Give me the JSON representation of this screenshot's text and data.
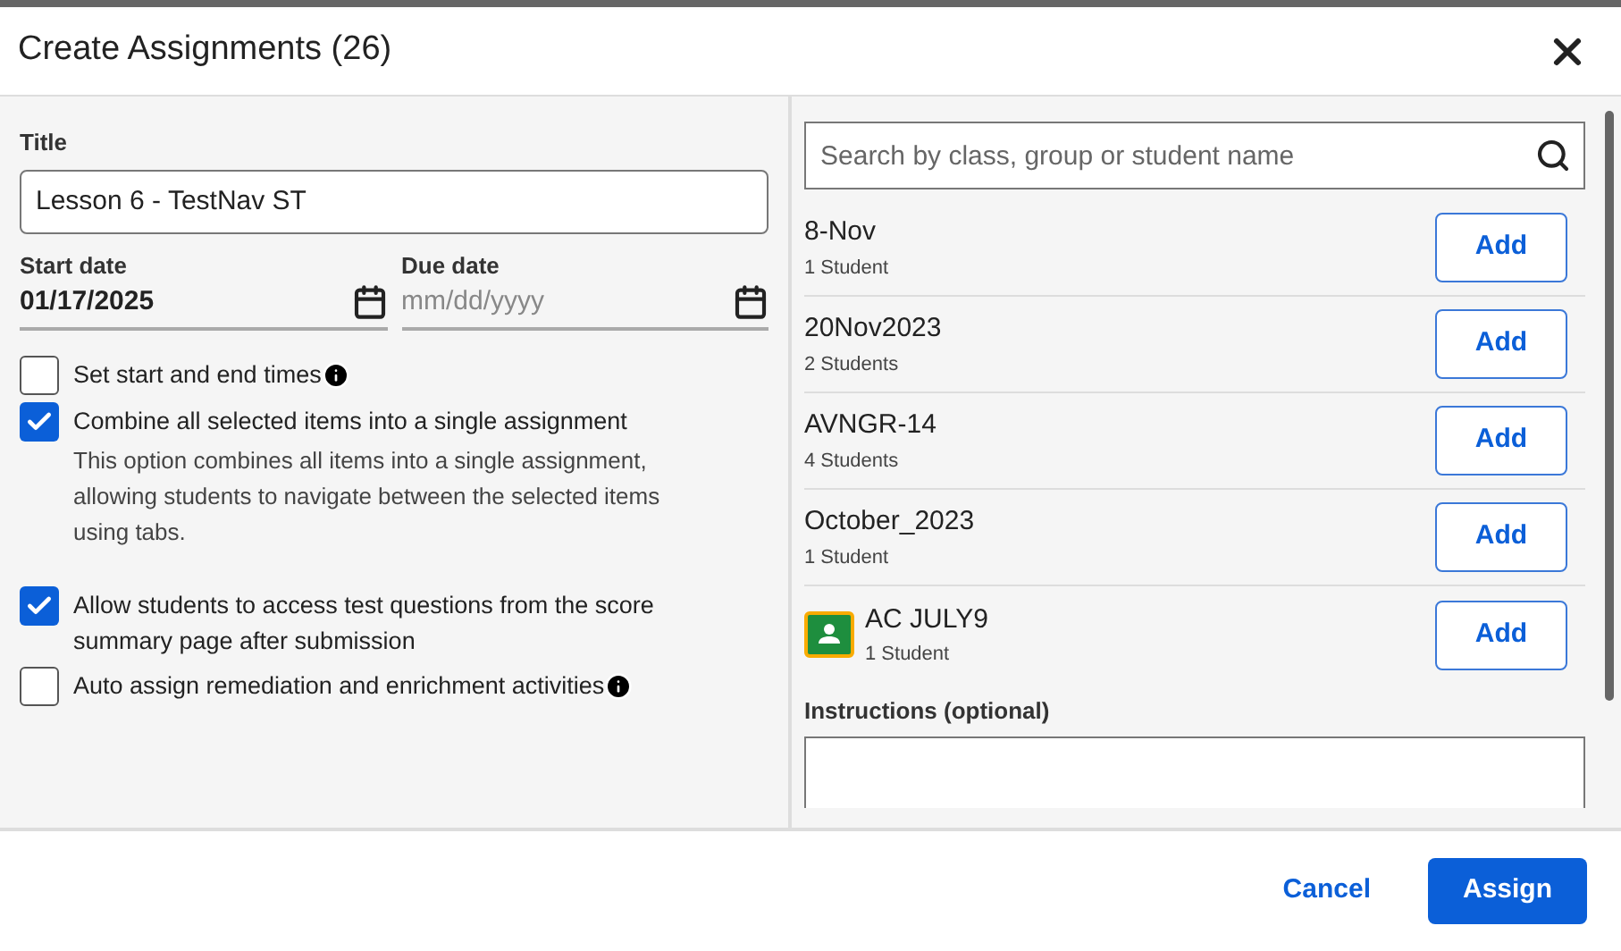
{
  "dialog": {
    "title": "Create Assignments (26)"
  },
  "form": {
    "title_label": "Title",
    "title_value": "Lesson 6 - TestNav ST",
    "start_date": {
      "label": "Start date",
      "value": "01/17/2025"
    },
    "due_date": {
      "label": "Due date",
      "placeholder": "mm/dd/yyyy"
    },
    "options": [
      {
        "label": "Set start and end times",
        "checked": false,
        "info": true
      },
      {
        "label": "Combine all selected items into a single assignment",
        "checked": true,
        "info": false,
        "description": "This option combines all items into a single assignment, allowing students to navigate between the selected items using tabs."
      },
      {
        "label": "Allow students to access test questions from the score summary page after submission",
        "checked": true,
        "info": false
      },
      {
        "label": "Auto assign remediation and enrichment activities",
        "checked": false,
        "info": true
      }
    ]
  },
  "search": {
    "placeholder": "Search by class, group or student name"
  },
  "classes": [
    {
      "name": "8-Nov",
      "count": "1 Student",
      "kind": "class",
      "button": "Add"
    },
    {
      "name": "20Nov2023",
      "count": "2 Students",
      "kind": "class",
      "button": "Add"
    },
    {
      "name": "AVNGR-14",
      "count": "4 Students",
      "kind": "class",
      "button": "Add"
    },
    {
      "name": "October_2023",
      "count": "1 Student",
      "kind": "class",
      "button": "Add"
    },
    {
      "name": "AC JULY9",
      "count": "1 Student",
      "kind": "classroom",
      "button": "Add"
    }
  ],
  "instructions": {
    "label": "Instructions (optional)"
  },
  "footer": {
    "cancel": "Cancel",
    "assign": "Assign"
  }
}
